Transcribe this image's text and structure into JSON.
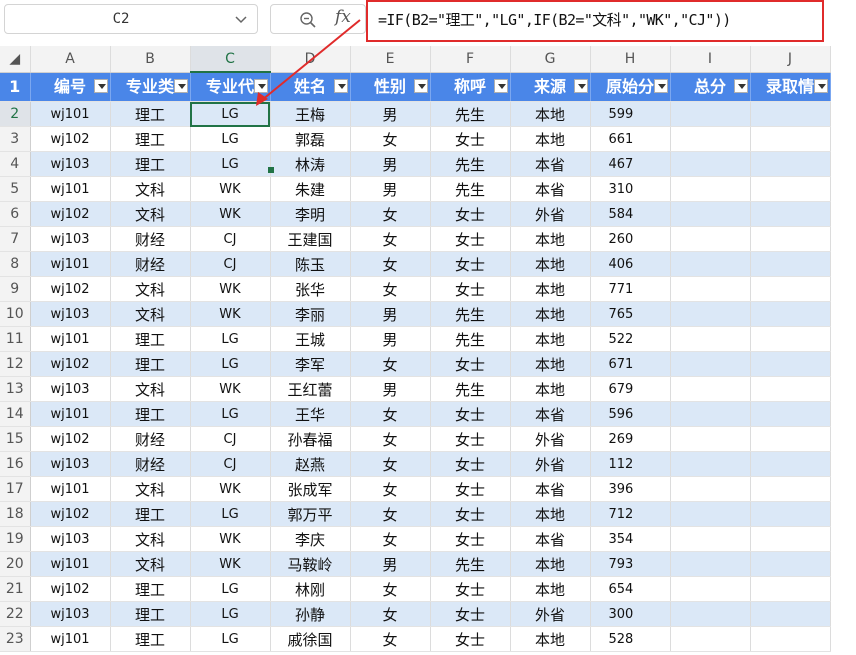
{
  "formula_bar": {
    "cell_ref": "C2",
    "formula": "=IF(B2=\"理工\",\"LG\",IF(B2=\"文科\",\"WK\",\"CJ\"))"
  },
  "columns": [
    "A",
    "B",
    "C",
    "D",
    "E",
    "F",
    "G",
    "H",
    "I",
    "J"
  ],
  "selected_column": "C",
  "selected_row": 2,
  "header_row": [
    "编号",
    "专业类",
    "专业代",
    "姓名",
    "性别",
    "称呼",
    "来源",
    "原始分",
    "总分",
    "录取情"
  ],
  "rows": [
    {
      "n": "2",
      "id": "wj101",
      "major": "理工",
      "code": "LG",
      "name": "王梅",
      "sex": "男",
      "title": "先生",
      "src": "本地",
      "score": "599"
    },
    {
      "n": "3",
      "id": "wj102",
      "major": "理工",
      "code": "LG",
      "name": "郭磊",
      "sex": "女",
      "title": "女士",
      "src": "本地",
      "score": "661"
    },
    {
      "n": "4",
      "id": "wj103",
      "major": "理工",
      "code": "LG",
      "name": "林涛",
      "sex": "男",
      "title": "先生",
      "src": "本省",
      "score": "467"
    },
    {
      "n": "5",
      "id": "wj101",
      "major": "文科",
      "code": "WK",
      "name": "朱建",
      "sex": "男",
      "title": "先生",
      "src": "本省",
      "score": "310"
    },
    {
      "n": "6",
      "id": "wj102",
      "major": "文科",
      "code": "WK",
      "name": "李明",
      "sex": "女",
      "title": "女士",
      "src": "外省",
      "score": "584"
    },
    {
      "n": "7",
      "id": "wj103",
      "major": "财经",
      "code": "CJ",
      "name": "王建国",
      "sex": "女",
      "title": "女士",
      "src": "本地",
      "score": "260"
    },
    {
      "n": "8",
      "id": "wj101",
      "major": "财经",
      "code": "CJ",
      "name": "陈玉",
      "sex": "女",
      "title": "女士",
      "src": "本地",
      "score": "406"
    },
    {
      "n": "9",
      "id": "wj102",
      "major": "文科",
      "code": "WK",
      "name": "张华",
      "sex": "女",
      "title": "女士",
      "src": "本地",
      "score": "771"
    },
    {
      "n": "10",
      "id": "wj103",
      "major": "文科",
      "code": "WK",
      "name": "李丽",
      "sex": "男",
      "title": "先生",
      "src": "本地",
      "score": "765"
    },
    {
      "n": "11",
      "id": "wj101",
      "major": "理工",
      "code": "LG",
      "name": "王城",
      "sex": "男",
      "title": "先生",
      "src": "本地",
      "score": "522"
    },
    {
      "n": "12",
      "id": "wj102",
      "major": "理工",
      "code": "LG",
      "name": "李军",
      "sex": "女",
      "title": "女士",
      "src": "本地",
      "score": "671"
    },
    {
      "n": "13",
      "id": "wj103",
      "major": "文科",
      "code": "WK",
      "name": "王红蕾",
      "sex": "男",
      "title": "先生",
      "src": "本地",
      "score": "679"
    },
    {
      "n": "14",
      "id": "wj101",
      "major": "理工",
      "code": "LG",
      "name": "王华",
      "sex": "女",
      "title": "女士",
      "src": "本省",
      "score": "596"
    },
    {
      "n": "15",
      "id": "wj102",
      "major": "财经",
      "code": "CJ",
      "name": "孙春福",
      "sex": "女",
      "title": "女士",
      "src": "外省",
      "score": "269"
    },
    {
      "n": "16",
      "id": "wj103",
      "major": "财经",
      "code": "CJ",
      "name": "赵燕",
      "sex": "女",
      "title": "女士",
      "src": "外省",
      "score": "112"
    },
    {
      "n": "17",
      "id": "wj101",
      "major": "文科",
      "code": "WK",
      "name": "张成军",
      "sex": "女",
      "title": "女士",
      "src": "本省",
      "score": "396"
    },
    {
      "n": "18",
      "id": "wj102",
      "major": "理工",
      "code": "LG",
      "name": "郭万平",
      "sex": "女",
      "title": "女士",
      "src": "本地",
      "score": "712"
    },
    {
      "n": "19",
      "id": "wj103",
      "major": "文科",
      "code": "WK",
      "name": "李庆",
      "sex": "女",
      "title": "女士",
      "src": "本省",
      "score": "354"
    },
    {
      "n": "20",
      "id": "wj101",
      "major": "文科",
      "code": "WK",
      "name": "马鞍岭",
      "sex": "男",
      "title": "先生",
      "src": "本地",
      "score": "793"
    },
    {
      "n": "21",
      "id": "wj102",
      "major": "理工",
      "code": "LG",
      "name": "林刚",
      "sex": "女",
      "title": "女士",
      "src": "本地",
      "score": "654"
    },
    {
      "n": "22",
      "id": "wj103",
      "major": "理工",
      "code": "LG",
      "name": "孙静",
      "sex": "女",
      "title": "女士",
      "src": "外省",
      "score": "300"
    },
    {
      "n": "23",
      "id": "wj101",
      "major": "理工",
      "code": "LG",
      "name": "戚徐国",
      "sex": "女",
      "title": "女士",
      "src": "本地",
      "score": "528"
    }
  ],
  "colors": {
    "header_fill": "#4a86e8",
    "band_fill": "#dbe8f7",
    "selection": "#217346",
    "annotation": "#e02b2b"
  },
  "icons": {
    "zoom": "zoom-icon",
    "fx": "fx-icon",
    "chevron": "chevron-down-icon",
    "filter": "filter-dropdown-icon"
  }
}
